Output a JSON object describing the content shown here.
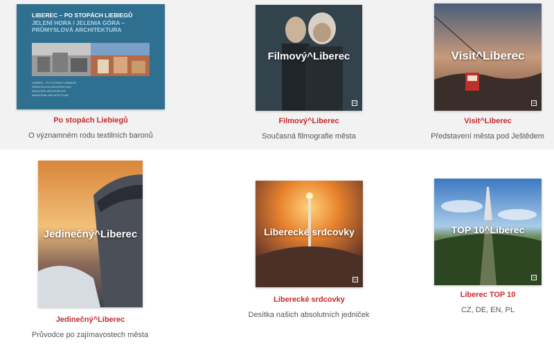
{
  "colors": {
    "title_red": "#c8282d",
    "row_bg": "#f2f2f2"
  },
  "items": [
    {
      "title": "Po stopách Liebiegů",
      "desc": "O významném rodu textilních baronů",
      "cover": {
        "line1": "LIBEREC – PO STOPÁCH LIEBIEGŮ",
        "line2": "JELENÍ HORA / JELENIA GÓRA –",
        "line3": "PRŮMYSLOVÁ ARCHITEKTURA",
        "small1": "LIBEREC – PO STOPÁCH LIEBIEGŮ",
        "small2": "PRŮMYSLOVÁ ARCHITEKTURA",
        "small3": "INDUSTRIE-ARCHITEKTUR",
        "small4": "INDUSTRIAL ARCHITECTURE"
      }
    },
    {
      "title": "Filmový^Liberec",
      "desc": "Současná filmografie města",
      "cover": {
        "overlay": "Filmový^Liberec",
        "badge": "CZ"
      }
    },
    {
      "title": "Visit^Liberec",
      "desc": "Představení města pod Ještědem",
      "cover": {
        "overlay": "Visit^Liberec",
        "badge": "CZ"
      }
    },
    {
      "title": "Jedinečný^Liberec",
      "desc": "Průvodce po zajímavostech města",
      "cover": {
        "overlay": "Jedinečný^Liberec"
      }
    },
    {
      "title": "Liberecké srdcovky",
      "desc": "Desítka našich absolutních jedniček",
      "cover": {
        "overlay": "Liberecké srdcovky",
        "badge": "CZ"
      }
    },
    {
      "title": "Liberec TOP 10",
      "desc": "CZ, DE, EN, PL",
      "cover": {
        "overlay": "TOP 10^Liberec",
        "badge": "CZ"
      }
    }
  ]
}
